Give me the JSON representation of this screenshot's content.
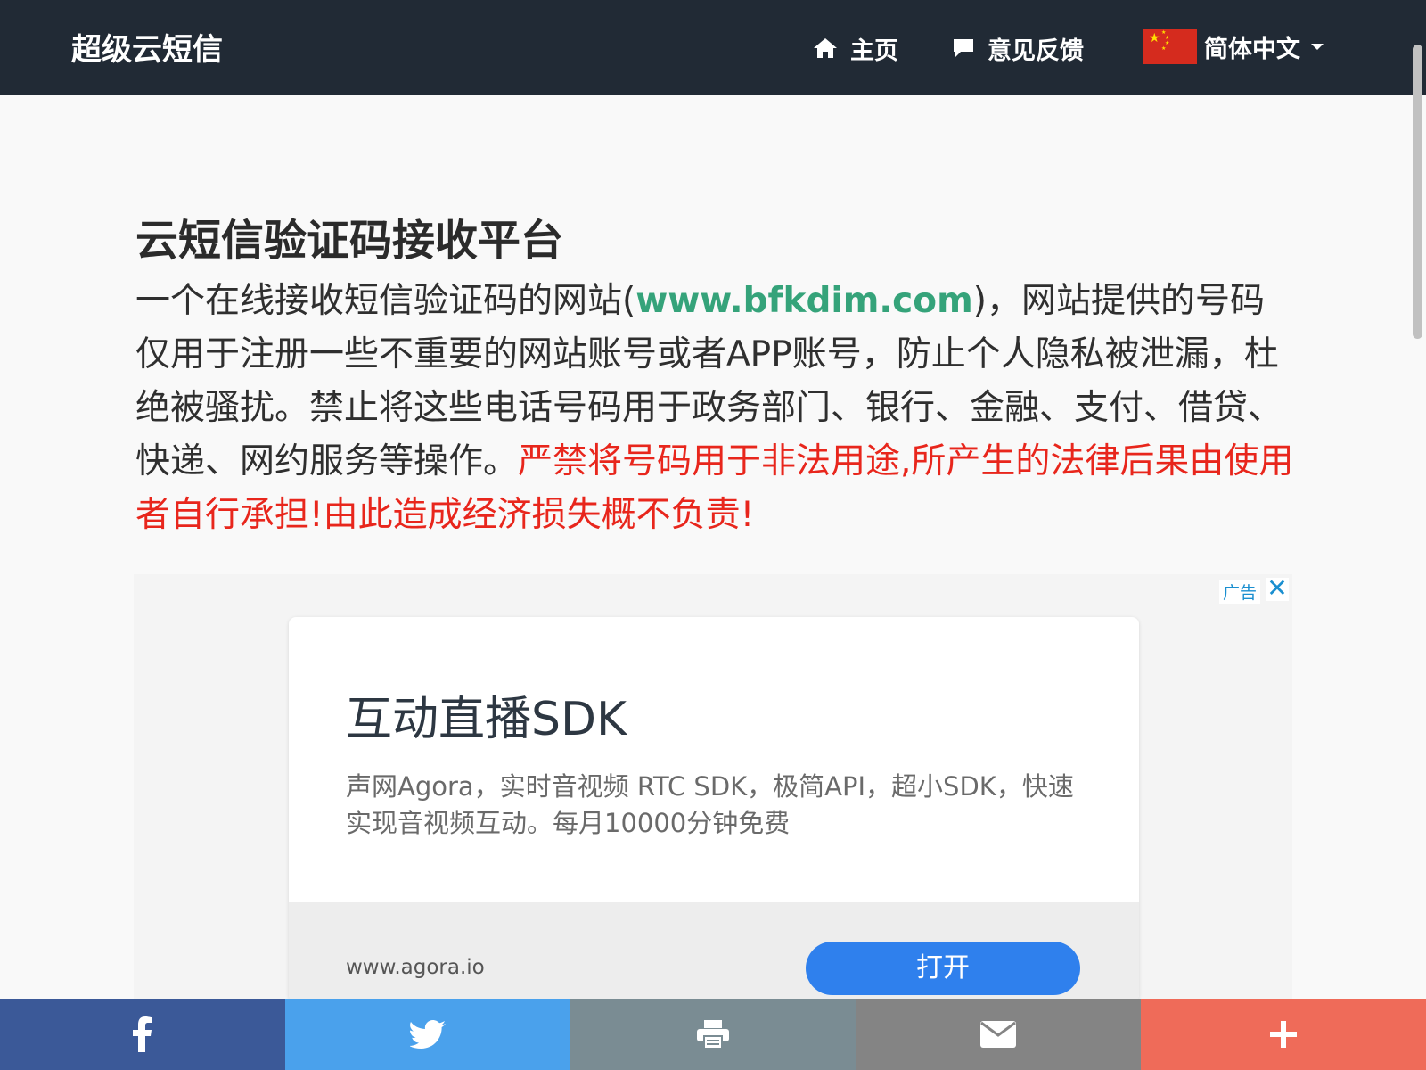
{
  "nav": {
    "brand": "超级云短信",
    "home_label": "主页",
    "feedback_label": "意见反馈",
    "language_label": "简体中文"
  },
  "main": {
    "title": "云短信验证码接收平台",
    "desc_prefix": "一个在线接收短信验证码的网站(",
    "site_link": "www.bfkdim.com",
    "desc_middle": ")，网站提供的号码仅用于注册一些不重要的网站账号或者APP账号，防止个人隐私被泄漏，杜绝被骚扰。禁止将这些电话号码用于政务部门、银行、金融、支付、借贷、快递、网约服务等操作。",
    "desc_warning": "严禁将号码用于非法用途,所产生的法律后果由使用者自行承担!由此造成经济损失概不负责!"
  },
  "ad": {
    "label": "广告",
    "close": "✕",
    "title": "互动直播SDK",
    "text": "声网Agora，实时音视频 RTC SDK，极简API，超小SDK，快速实现音视频互动。每月10000分钟免费",
    "url": "www.agora.io",
    "open_label": "打开"
  },
  "share": [
    {
      "name": "facebook",
      "color": "#3b5998",
      "icon": "facebook-icon"
    },
    {
      "name": "twitter",
      "color": "#4aa1ec",
      "icon": "twitter-icon"
    },
    {
      "name": "print",
      "color": "#7a8c93",
      "icon": "print-icon"
    },
    {
      "name": "email",
      "color": "#848484",
      "icon": "email-icon"
    },
    {
      "name": "more",
      "color": "#ef6b59",
      "icon": "plus-icon"
    }
  ]
}
